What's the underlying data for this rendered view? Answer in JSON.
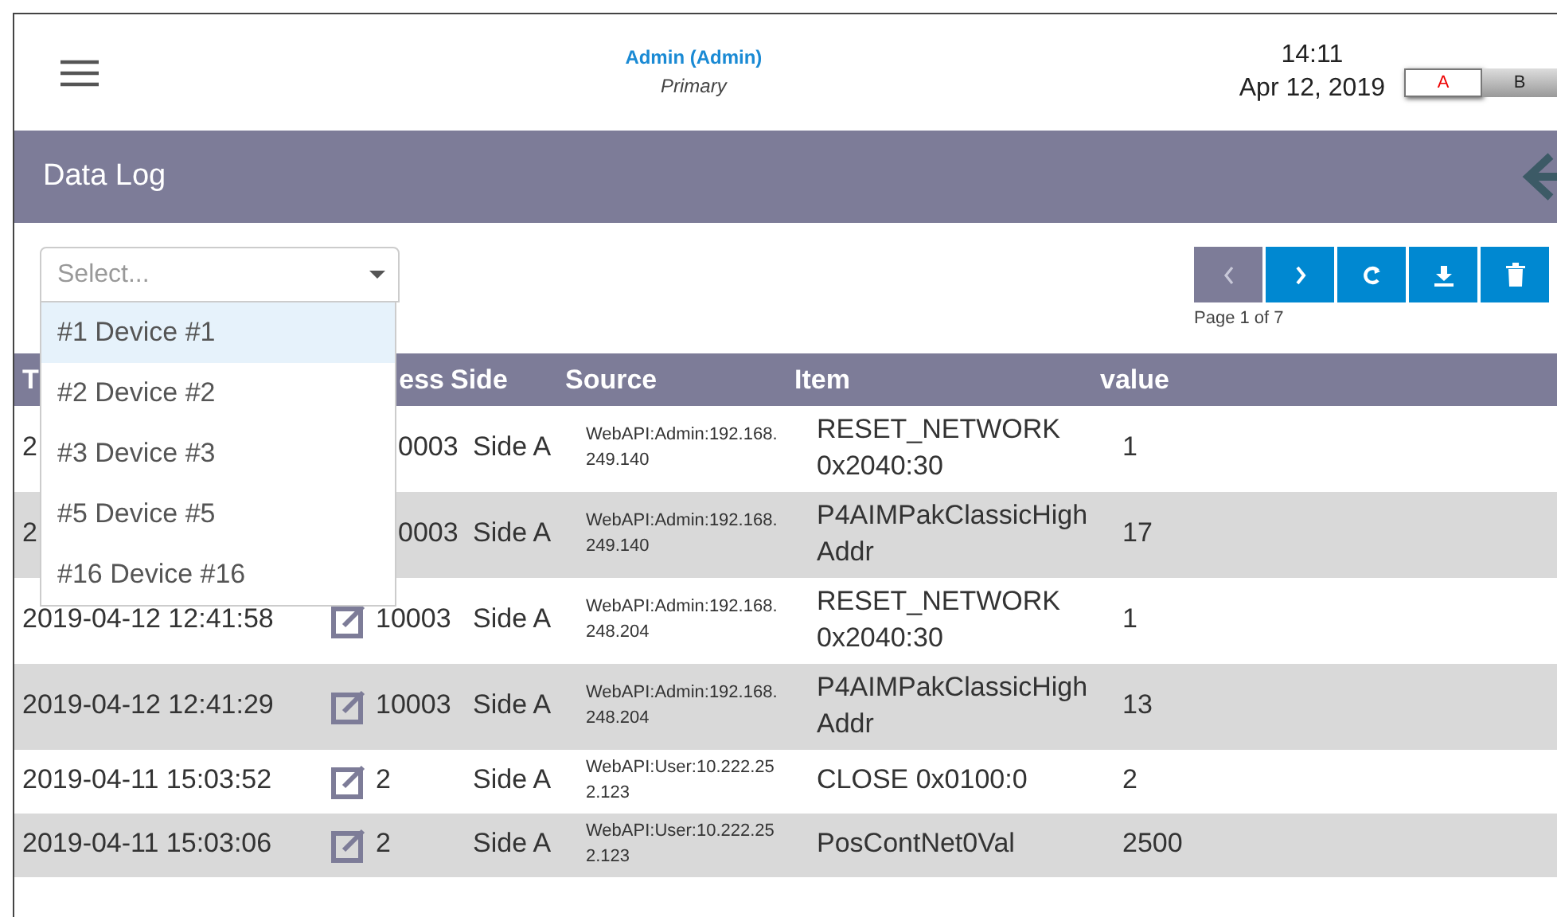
{
  "header": {
    "user": "Admin (Admin)",
    "role": "Primary",
    "time": "14:11",
    "date": "Apr 12, 2019",
    "sides": [
      {
        "label": "A",
        "selected": true
      },
      {
        "label": "B",
        "selected": false
      }
    ]
  },
  "title": "Data Log",
  "device_select": {
    "placeholder": "Select...",
    "expanded": true,
    "options": [
      {
        "label": "#1 Device #1",
        "selected": true
      },
      {
        "label": "#2 Device #2",
        "selected": false
      },
      {
        "label": "#3 Device #3",
        "selected": false
      },
      {
        "label": "#5 Device #5",
        "selected": false
      },
      {
        "label": "#16 Device #16",
        "selected": false
      }
    ]
  },
  "pager": {
    "buttons": [
      {
        "kind": "prev",
        "disabled": true
      },
      {
        "kind": "next",
        "disabled": false
      },
      {
        "kind": "refresh",
        "disabled": false
      },
      {
        "kind": "download",
        "disabled": false
      },
      {
        "kind": "delete",
        "disabled": false
      }
    ],
    "page_label": "Page 1 of 7"
  },
  "table": {
    "columns": [
      "T",
      "ess",
      "Side",
      "Source",
      "Item",
      "value"
    ],
    "rows": [
      {
        "time": "2",
        "edit_icon": false,
        "address": "0003",
        "side": "Side A",
        "source": "WebAPI:Admin:192.168.249.140",
        "item": "RESET_NETWORK 0x2040:30",
        "value": "1"
      },
      {
        "time": "2",
        "edit_icon": false,
        "address": "0003",
        "side": "Side A",
        "source": "WebAPI:Admin:192.168.249.140",
        "item": "P4AIMPakClassicHighAddr",
        "value": "17"
      },
      {
        "time": "2019-04-12 12:41:58",
        "edit_icon": true,
        "address": "10003",
        "side": "Side A",
        "source": "WebAPI:Admin:192.168.248.204",
        "item": "RESET_NETWORK 0x2040:30",
        "value": "1"
      },
      {
        "time": "2019-04-12 12:41:29",
        "edit_icon": true,
        "address": "10003",
        "side": "Side A",
        "source": "WebAPI:Admin:192.168.248.204",
        "item": "P4AIMPakClassicHighAddr",
        "value": "13"
      },
      {
        "time": "2019-04-11 15:03:52",
        "edit_icon": true,
        "address": "2",
        "side": "Side A",
        "source": "WebAPI:User:10.222.252.123",
        "item": "CLOSE 0x0100:0",
        "value": "2"
      },
      {
        "time": "2019-04-11 15:03:06",
        "edit_icon": true,
        "address": "2",
        "side": "Side A",
        "source": "WebAPI:User:10.222.252.123",
        "item": "PosContNet0Val",
        "value": "2500"
      }
    ]
  }
}
